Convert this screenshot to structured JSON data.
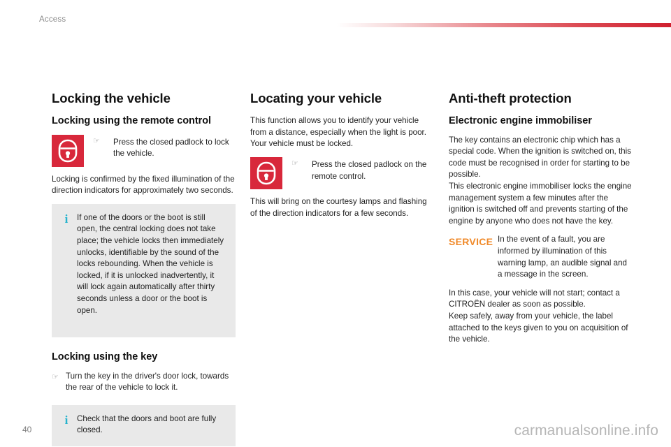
{
  "header": {
    "chapter": "Access",
    "accent_color": "#d0202f"
  },
  "columns": {
    "left": {
      "title": "Locking the vehicle",
      "subtitle": "Locking using the remote control",
      "padlock_instruction": "Press the closed padlock to lock the vehicle.",
      "paragraph": "Locking is confirmed by the fixed illumination of the direction indicators for approximately two seconds.",
      "info_box": "If one of the doors or the boot is still open, the central locking does not take place; the vehicle locks then immediately unlocks, identifiable by the sound of the locks rebounding. When the vehicle is locked, if it is unlocked inadvertently, it will lock again automatically after thirty seconds unless a door or the boot is open.",
      "key_subtitle": "Locking using the key",
      "key_instruction": "Turn the key in the driver's door lock, towards the rear of the vehicle to lock it.",
      "key_info_box": "Check that the doors and boot are fully closed."
    },
    "middle": {
      "title": "Locating your vehicle",
      "paragraph_1": "This function allows you to identify your vehicle from a distance, especially when the light is poor. Your vehicle must be locked.",
      "padlock_instruction": "Press the closed padlock on the remote control.",
      "paragraph_2": "This will bring on the courtesy lamps and flashing of the direction indicators for a few seconds."
    },
    "right": {
      "title": "Anti-theft protection",
      "subtitle": "Electronic engine immobiliser",
      "paragraph_1": "The key contains an electronic chip which has a special code. When the ignition is switched on, this code must be recognised in order for starting to be possible.",
      "paragraph_2": "This electronic engine immobiliser locks the engine management system a few minutes after the ignition is switched off and prevents starting of the engine by anyone who does not have the key.",
      "service_badge": "SERVICE",
      "service_text": "In the event of a fault, you are informed by illumination of this warning lamp, an audible signal and a message in the screen.",
      "paragraph_3": "In this case, your vehicle will not start; contact a CITROËN dealer as soon as possible.",
      "paragraph_4": "Keep safely, away from your vehicle, the label attached to the keys given to you on acquisition of the vehicle."
    }
  },
  "glyphs": {
    "hand_pointer": "☞",
    "info": "i"
  },
  "footer": {
    "page_number": "40",
    "watermark": "carmanualsonline.info"
  },
  "colors": {
    "padlock_tile": "#d8283b",
    "info_icon": "#26b3cd",
    "service": "#f08a2a",
    "info_box_bg": "#e9e9e9"
  }
}
